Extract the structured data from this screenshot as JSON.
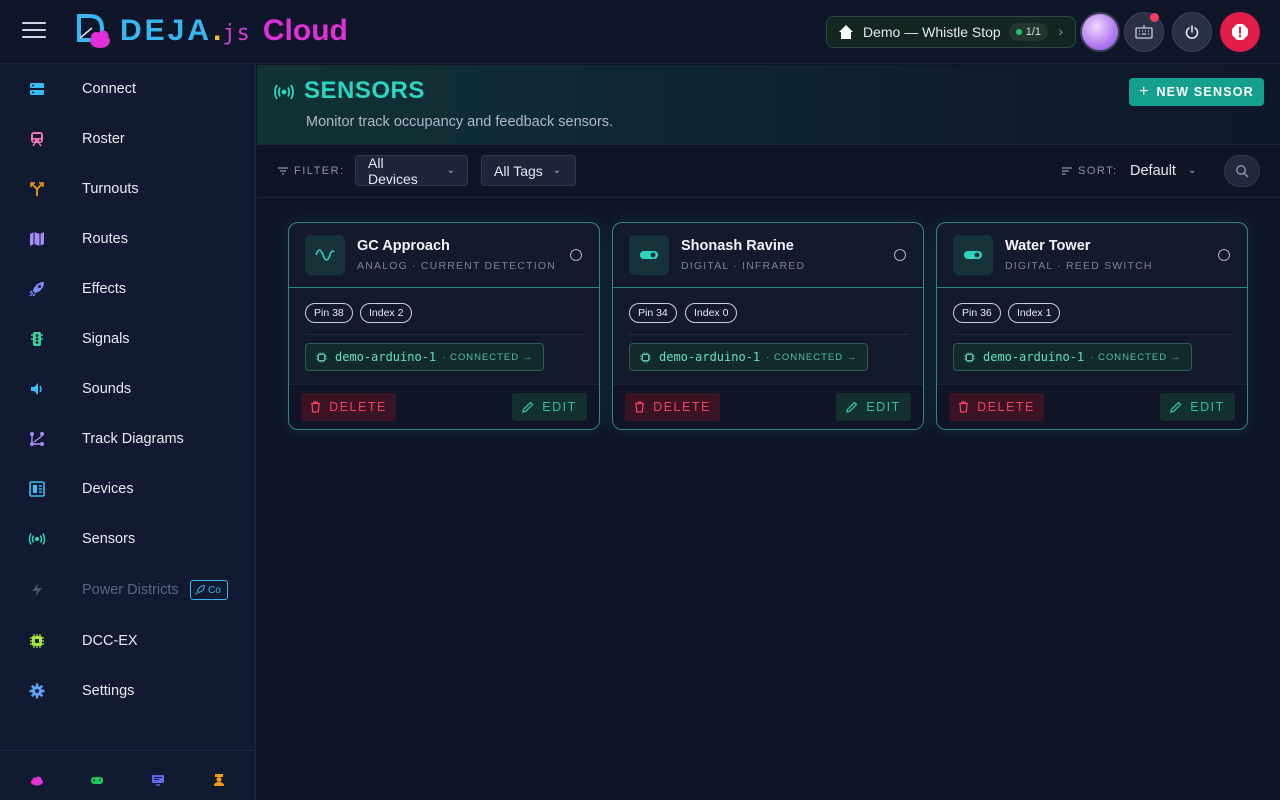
{
  "header": {
    "logo": {
      "deja": "DEJA",
      "dot": ".",
      "js": "js",
      "cloud": "Cloud"
    },
    "layout": {
      "name": "Demo — Whistle Stop",
      "count": "1/1"
    }
  },
  "sidebar": {
    "items": [
      {
        "label": "Connect",
        "icon": "server-icon",
        "color": "#38bdf8"
      },
      {
        "label": "Roster",
        "icon": "train-icon",
        "color": "#f472b6"
      },
      {
        "label": "Turnouts",
        "icon": "fork-icon",
        "color": "#f59e0b"
      },
      {
        "label": "Routes",
        "icon": "map-icon",
        "color": "#a78bfa"
      },
      {
        "label": "Effects",
        "icon": "rocket-icon",
        "color": "#818cf8"
      },
      {
        "label": "Signals",
        "icon": "traffic-light-icon",
        "color": "#34d399"
      },
      {
        "label": "Sounds",
        "icon": "speaker-icon",
        "color": "#38bdf8"
      },
      {
        "label": "Track Diagrams",
        "icon": "diagram-icon",
        "color": "#a78bfa"
      },
      {
        "label": "Devices",
        "icon": "chip-board-icon",
        "color": "#38bdf8"
      },
      {
        "label": "Sensors",
        "icon": "broadcast-icon",
        "color": "#2dd4bf"
      },
      {
        "label": "Power Districts",
        "icon": "bolt-icon",
        "color": "#4b5563",
        "badge": "Co"
      },
      {
        "label": "DCC-EX",
        "icon": "cpu-icon",
        "color": "#a3e635"
      },
      {
        "label": "Settings",
        "icon": "gear-icon",
        "color": "#60a5fa"
      }
    ],
    "footer_icons": [
      {
        "icon": "cloud-icon",
        "color": "#e030d8"
      },
      {
        "icon": "gamepad-icon",
        "color": "#22c55e"
      },
      {
        "icon": "monitor-icon",
        "color": "#6366f1"
      },
      {
        "icon": "conductor-icon",
        "color": "#f59e0b"
      }
    ]
  },
  "page": {
    "title": "SENSORS",
    "subtitle": "Monitor track occupancy and feedback sensors.",
    "new_button": "NEW SENSOR"
  },
  "filters": {
    "label": "FILTER:",
    "devices": "All Devices",
    "tags": "All Tags",
    "sort_label": "SORT:",
    "sort_value": "Default"
  },
  "sensors": [
    {
      "name": "GC Approach",
      "type": "ANALOG · CURRENT DETECTION",
      "icon": "wave-icon",
      "pin": "Pin 38",
      "index": "Index 2",
      "device": "demo-arduino-1",
      "status": "· CONNECTED →",
      "delete": "DELETE",
      "edit": "EDIT"
    },
    {
      "name": "Shonash Ravine",
      "type": "DIGITAL · INFRARED",
      "icon": "toggle-icon",
      "pin": "Pin 34",
      "index": "Index 0",
      "device": "demo-arduino-1",
      "status": "· CONNECTED →",
      "delete": "DELETE",
      "edit": "EDIT"
    },
    {
      "name": "Water Tower",
      "type": "DIGITAL · REED SWITCH",
      "icon": "toggle-icon",
      "pin": "Pin 36",
      "index": "Index 1",
      "device": "demo-arduino-1",
      "status": "· CONNECTED →",
      "delete": "DELETE",
      "edit": "EDIT"
    }
  ]
}
